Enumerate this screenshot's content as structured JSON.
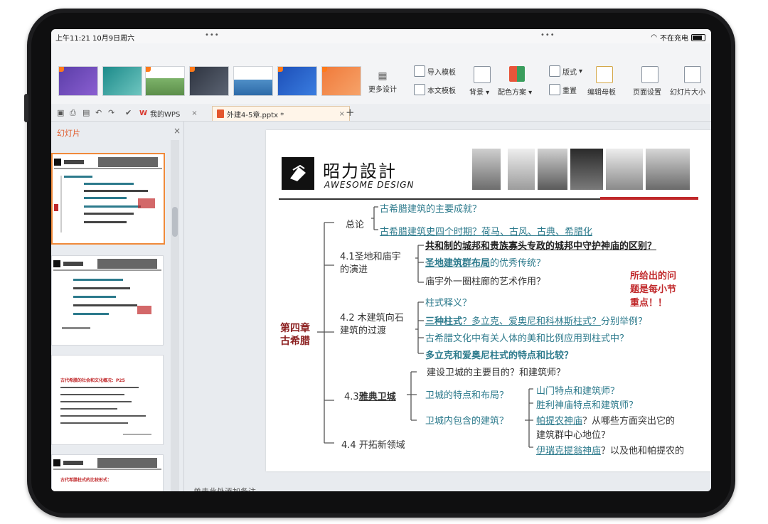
{
  "status": {
    "time": "上午11:21",
    "date": "10月9日周六",
    "dots": "•••",
    "wifi": "不在充电"
  },
  "ribbon": {
    "more_design": "更多设计",
    "import_template": "导入模板",
    "body_template": "本文模板",
    "background": "背景",
    "color_scheme": "配色方案",
    "layout": "版式",
    "reset": "重置",
    "edit_master": "编辑母板",
    "page_setup": "页面设置",
    "slide_size": "幻灯片大小"
  },
  "tabs": {
    "home": "我的WPS",
    "doc": "外建4-5章.pptx *",
    "add": "+",
    "close": "×"
  },
  "left_panel": {
    "title": "幻灯片",
    "close": "×"
  },
  "notes": {
    "placeholder": "单击此处添加备注"
  },
  "slide": {
    "brand_cn": "昭力設計",
    "brand_en": "AWESOME DESIGN",
    "chapter": "第四章\n古希腊",
    "overview": "总论",
    "ov1": "古希腊建筑的主要成就？",
    "ov2": "古希腊建筑史四个时期？荷马、古风、古典、希腊化",
    "s41": "4.1圣地和庙宇\n的演进",
    "s41a": "共和制的城邦和贵族寡头专政的城邦中守护神庙的区别？",
    "s41b": "圣地建筑群布局",
    "s41b2": "的优秀传统？",
    "s41c": "庙宇外一圈柱廊的艺术作用？",
    "s42": "4.2 木建筑向石\n建筑的过渡",
    "s42a": "柱式释义？",
    "s42b": "三种柱式",
    "s42b2": "？多立克、爱奥尼和科林斯柱式？",
    "s42b3": "分别举例？",
    "s42c": "古希腊文化中有关人体的美和比例应用到柱式中？",
    "s42d": "多立克和爱奥尼柱式的特点和比较？",
    "s43_pre": "4.3",
    "s43": "雅典卫城",
    "s43a": "建设卫城的主要目的？和建筑师？",
    "s43b": "卫城的特点和布局？",
    "s43c": "卫城内包含的建筑？",
    "s43c1": "山门特点和建筑师？",
    "s43c2": "胜利神庙特点和建筑师？",
    "s43c3a": "帕提农神庙",
    "s43c3b": "？从哪些方面突出它的",
    "s43c3c": "建筑群中心地位？",
    "s43c4a": "伊瑞克提翁神庙",
    "s43c4b": "？以及他和帕提农的",
    "s44": "4.4 开拓新领域",
    "callout": "所给出的问\n题是每小节\n重点！！"
  },
  "thumb3": {
    "heading": "古代希腊的社会和文化概况：P25"
  },
  "thumb4": {
    "heading": "古代希腊柱式的比较形式："
  }
}
